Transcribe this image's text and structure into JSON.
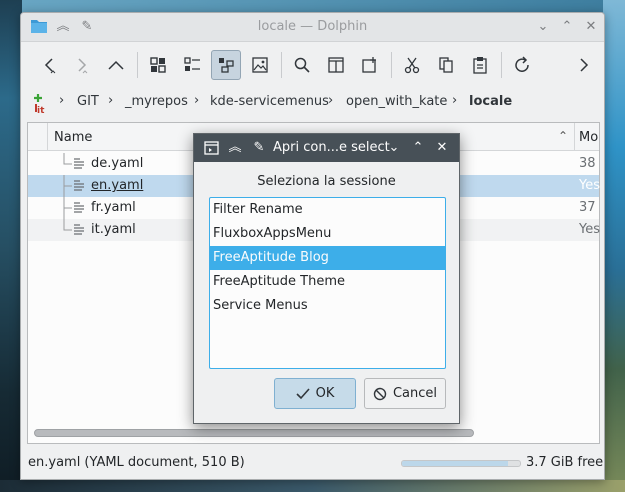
{
  "window": {
    "title": "locale — Dolphin"
  },
  "breadcrumb": {
    "items": [
      "GIT",
      "_myrepos",
      "kde-servicemenus",
      "open_with_kate",
      "locale"
    ]
  },
  "columns": {
    "name": "Name",
    "modified": "Mo"
  },
  "files": [
    {
      "name": "de.yaml",
      "modified": "38"
    },
    {
      "name": "en.yaml",
      "modified": "Yes"
    },
    {
      "name": "fr.yaml",
      "modified": "37"
    },
    {
      "name": "it.yaml",
      "modified": "Yes"
    }
  ],
  "status": {
    "text": "en.yaml (YAML document, 510 B)",
    "free": "3.7 GiB free",
    "usage_fraction": 0.9
  },
  "dialog": {
    "title": "Apri con...e select",
    "heading": "Seleziona la sessione",
    "sessions": [
      "Filter Rename",
      "FluxboxAppsMenu",
      "FreeAptitude Blog",
      "FreeAptitude Theme",
      "Service Menus"
    ],
    "selected_index": 2,
    "ok_label": "OK",
    "cancel_label": "Cancel"
  },
  "colors": {
    "accent": "#3daee9",
    "dialog_title_bg": "#475057",
    "selection_row": "#bfd9ee"
  }
}
